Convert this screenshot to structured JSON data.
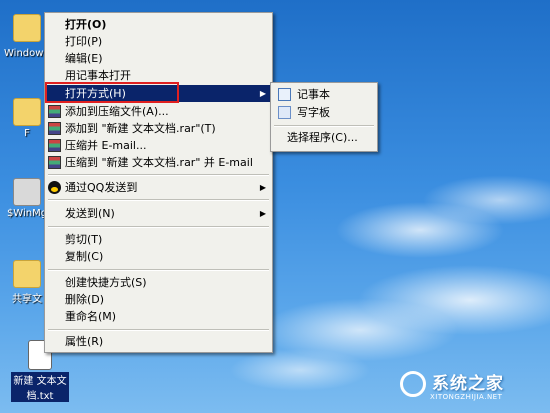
{
  "desktop": {
    "icons": [
      {
        "label": "Windows 管理"
      },
      {
        "label": "F"
      },
      {
        "label": "$WinMg"
      },
      {
        "label": "共享文"
      },
      {
        "label_line1": "新建 文本文",
        "label_line2": "档.txt"
      }
    ]
  },
  "context_menu": {
    "items": [
      {
        "label": "打开(O)"
      },
      {
        "label": "打印(P)"
      },
      {
        "label": "编辑(E)"
      },
      {
        "label": "用记事本打开"
      },
      {
        "label": "打开方式(H)"
      },
      {
        "label": "添加到压缩文件(A)..."
      },
      {
        "label": "添加到 \"新建 文本文档.rar\"(T)"
      },
      {
        "label": "压缩并 E-mail..."
      },
      {
        "label": "压缩到 \"新建 文本文档.rar\" 并 E-mail"
      },
      {
        "label": "通过QQ发送到"
      },
      {
        "label": "发送到(N)"
      },
      {
        "label": "剪切(T)"
      },
      {
        "label": "复制(C)"
      },
      {
        "label": "创建快捷方式(S)"
      },
      {
        "label": "删除(D)"
      },
      {
        "label": "重命名(M)"
      },
      {
        "label": "属性(R)"
      }
    ]
  },
  "submenu": {
    "items": [
      {
        "label": "记事本"
      },
      {
        "label": "写字板"
      },
      {
        "label": "选择程序(C)..."
      }
    ]
  },
  "watermark": {
    "title": "系统之家",
    "subtitle": "XITONGZHIJIA.NET"
  }
}
